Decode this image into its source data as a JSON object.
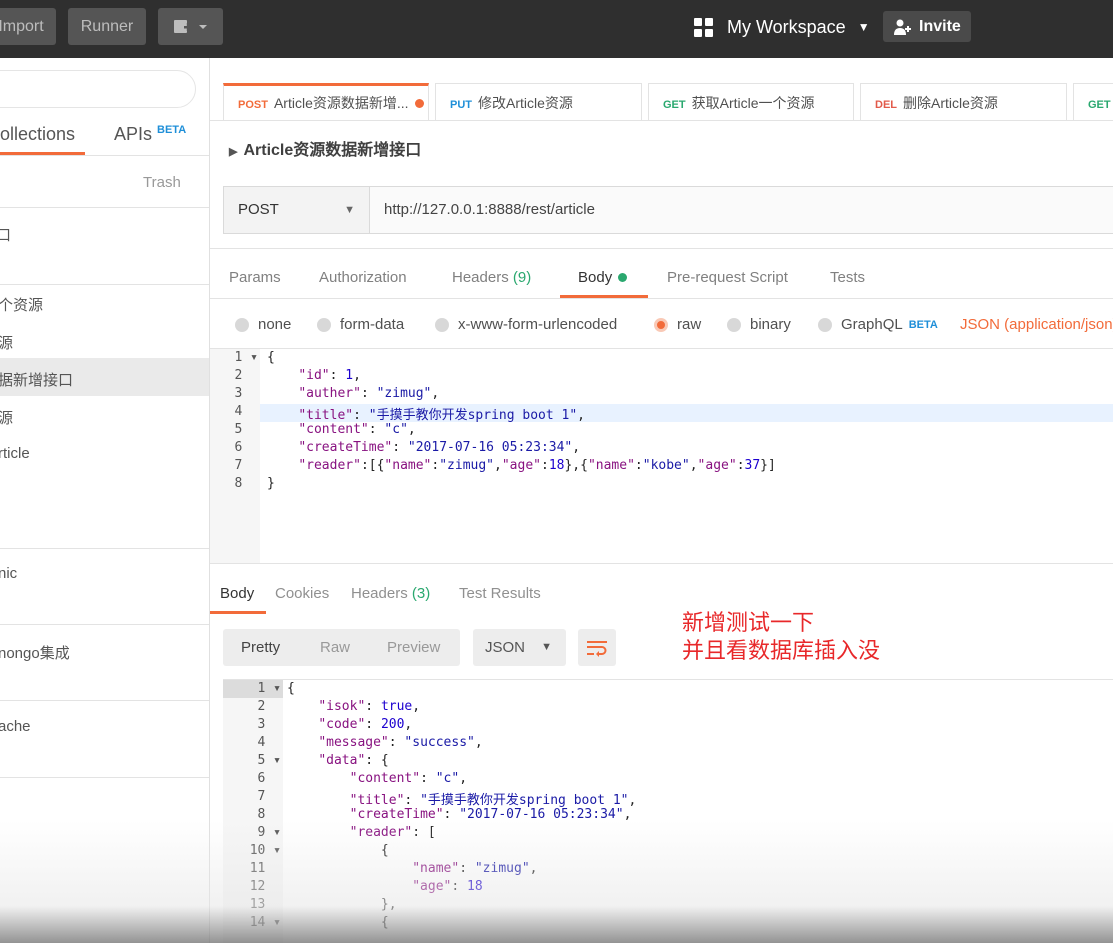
{
  "topbar": {
    "import_label": "Import",
    "runner_label": "Runner",
    "workspace_label": "My Workspace",
    "invite_label": "Invite"
  },
  "sidebar": {
    "tabs": [
      {
        "label": "Collections"
      },
      {
        "label": "APIs",
        "badge": "BETA"
      }
    ],
    "trash_label": "Trash",
    "items": [
      "口",
      "个资源",
      "源",
      "据新增接口",
      "源",
      "rticle",
      "nic",
      "nongo集成",
      "ache"
    ]
  },
  "tabs": [
    {
      "method": "POST",
      "label": "Article资源数据新增...",
      "color": "#f26b3a"
    },
    {
      "method": "PUT",
      "label": "修改Article资源",
      "color": "#1f8fd8"
    },
    {
      "method": "GET",
      "label": "获取Article一个资源",
      "color": "#2aa86f"
    },
    {
      "method": "DEL",
      "label": "删除Article资源",
      "color": "#e25a4a"
    },
    {
      "method": "GET",
      "label": "",
      "color": "#2aa86f"
    }
  ],
  "request": {
    "name": "Article资源数据新增接口",
    "method": "POST",
    "url": "http://127.0.0.1:8888/rest/article"
  },
  "request_tabs": {
    "params": "Params",
    "authorization": "Authorization",
    "headers": "Headers",
    "headers_count": "(9)",
    "body": "Body",
    "prerequest": "Pre-request Script",
    "tests": "Tests"
  },
  "body_types": {
    "none": "none",
    "form_data": "form-data",
    "urlencoded": "x-www-form-urlencoded",
    "raw": "raw",
    "binary": "binary",
    "graphql": "GraphQL",
    "graphql_badge": "BETA",
    "content_type": "JSON (application/json)"
  },
  "request_body": {
    "line_numbers": [
      "1",
      "2",
      "3",
      "4",
      "5",
      "6",
      "7",
      "8"
    ],
    "lines": [
      "{",
      "    \"id\": 1,",
      "    \"auther\": \"zimug\",",
      "    \"title\": \"手摸手教你开发spring boot 1\",",
      "    \"content\": \"c\",",
      "    \"createTime\": \"2017-07-16 05:23:34\",",
      "    \"reader\":[{\"name\":\"zimug\",\"age\":18},{\"name\":\"kobe\",\"age\":37}]",
      "}"
    ]
  },
  "response_tabs": {
    "body": "Body",
    "cookies": "Cookies",
    "headers": "Headers",
    "headers_count": "(3)",
    "test_results": "Test Results"
  },
  "response_view": {
    "pretty": "Pretty",
    "raw": "Raw",
    "preview": "Preview",
    "format": "JSON"
  },
  "annotation": "新增测试一下\n并且看数据库插入没",
  "response_body": {
    "line_numbers": [
      "1",
      "2",
      "3",
      "4",
      "5",
      "6",
      "7",
      "8",
      "9",
      "10",
      "11",
      "12",
      "13",
      "14"
    ],
    "lines": [
      "{",
      "    \"isok\": true,",
      "    \"code\": 200,",
      "    \"message\": \"success\",",
      "    \"data\": {",
      "        \"content\": \"c\",",
      "        \"title\": \"手摸手教你开发spring boot 1\",",
      "        \"createTime\": \"2017-07-16 05:23:34\",",
      "        \"reader\": [",
      "            {",
      "                \"name\": \"zimug\",",
      "                \"age\": 18",
      "            },",
      "            {"
    ]
  }
}
